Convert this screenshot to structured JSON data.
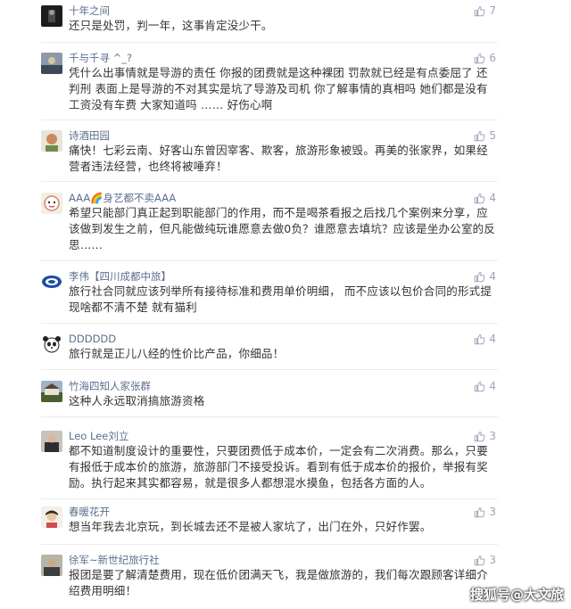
{
  "comments": [
    {
      "user": "十年之间",
      "likes": "7",
      "text": "还只是处罚，判一年，这事肯定没少干。"
    },
    {
      "user": "千与千寻 ^_?",
      "likes": "6",
      "text": "凭什么出事情就是导游的责任 你报的团费就是这种裸团 罚款就已经是有点委屈了 还判刑 表面上是导游的不对其实是坑了导游及司机 你了解事情的真相吗 她们都是没有工资没有车费 大家知道吗 …… 好伤心啊"
    },
    {
      "user": "诗酒田园",
      "likes": "5",
      "text": "痛快！七彩云南、好客山东曾因宰客、欺客，旅游形象被毁。再美的张家界，如果经营者违法经营，也终将被唾弃！"
    },
    {
      "user": "AAA🌈身艺都不卖AAA",
      "likes": "4",
      "text": "希望只能部门真正起到职能部门的作用，而不是喝茶看报之后找几个案例来分享，应该做到发生之前，但凡能做纯玩谁愿意去做0负？谁愿意去填坑？应该是坐办公室的反思……"
    },
    {
      "user": "李伟【四川成都中旅】",
      "likes": "4",
      "text": "旅行社合同就应该列举所有接待标准和费用单价明细， 而不应该以包价合同的形式提现啥都不清不楚 就有猫利"
    },
    {
      "user": "DDDDDD",
      "likes": "4",
      "text": "旅行就是正儿八经的性价比产品，你细品！"
    },
    {
      "user": "竹海四知人家张群",
      "likes": "4",
      "text": "这种人永远取消搞旅游资格"
    },
    {
      "user": "Leo Lee刘立",
      "likes": "3",
      "text": "都不知道制度设计的重要性，只要团费低于成本价，一定会有二次消费。那么，只要有报低于成本价的旅游，旅游部门不接受投诉。看到有低于成本价的报价，举报有奖励。执行起来其实都容易，就是很多人都想混水摸鱼，包括各方面的人。"
    },
    {
      "user": "春暖花开",
      "likes": "3",
      "text": "想当年我去北京玩，到长城去还不是被人家坑了，出门在外，只好作罢。"
    },
    {
      "user": "徐军~新世纪旅行社",
      "likes": "3",
      "text": "报团是要了解清楚费用，现在低价团满天飞，我是做旅游的，我们每次跟顾客详细介绍费用明细！"
    }
  ],
  "watermark": "搜狐号@大文旅",
  "colors": {
    "username": "#5a6f8f",
    "like": "#9aa5b6",
    "text": "#333333"
  }
}
